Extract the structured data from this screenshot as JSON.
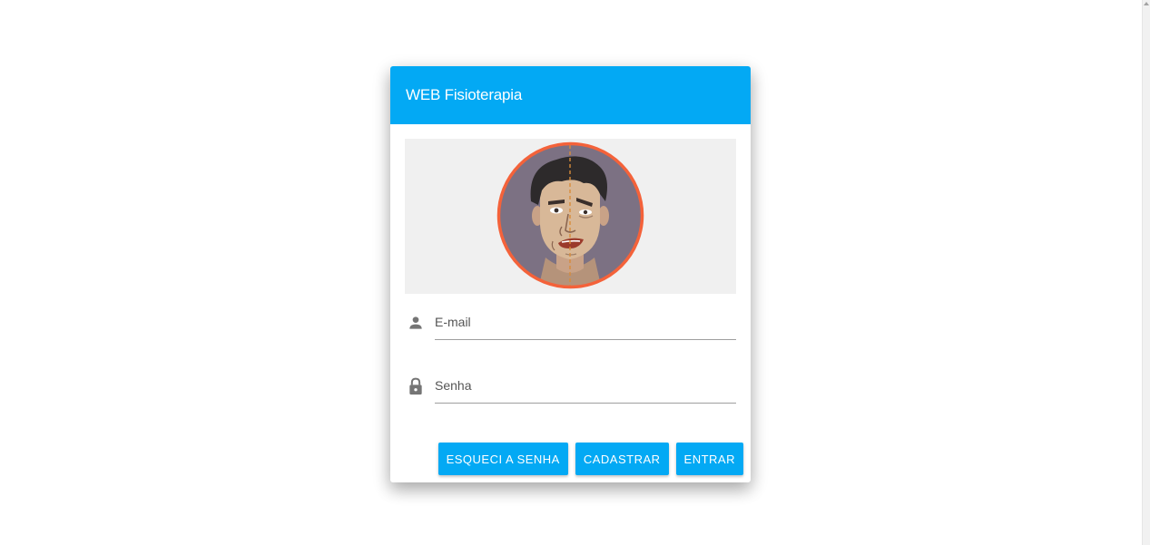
{
  "app": {
    "title": "WEB Fisioterapia"
  },
  "illustration": {
    "subject": "facial-palsy-face-illustration"
  },
  "form": {
    "email": {
      "placeholder": "E-mail",
      "value": "",
      "icon": "person-icon"
    },
    "password": {
      "placeholder": "Senha",
      "value": "",
      "icon": "lock-icon"
    }
  },
  "actions": {
    "forgot_label": "Esqueci a senha",
    "register_label": "Cadastrar",
    "login_label": "Entrar"
  },
  "colors": {
    "primary": "#03a9f4",
    "avatar_border": "#f4623a",
    "avatar_bg": "#7c7183",
    "icon_gray": "#757575"
  }
}
